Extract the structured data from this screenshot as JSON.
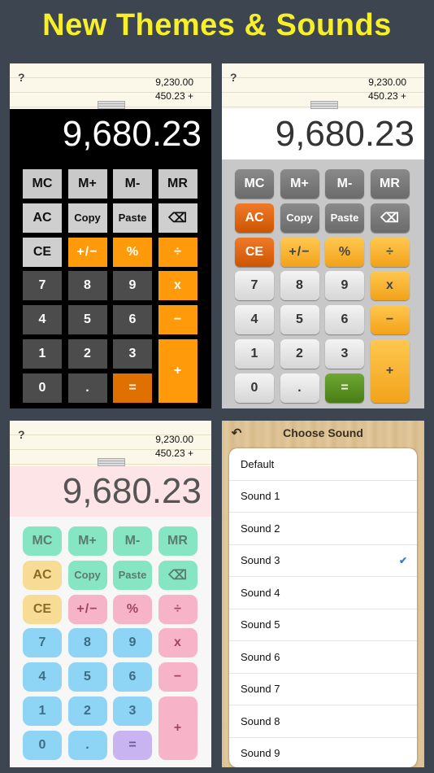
{
  "headline": "New Themes & Sounds",
  "tape": {
    "help": "?",
    "line1": "9,230.00",
    "line2": "450.23  +"
  },
  "display": "9,680.23",
  "keys": {
    "mc": "MC",
    "mplus": "M+",
    "mminus": "M-",
    "mr": "MR",
    "ac": "AC",
    "copy": "Copy",
    "paste": "Paste",
    "backspace": "⌫",
    "ce": "CE",
    "plusminus": "+/−",
    "percent": "%",
    "divide": "÷",
    "seven": "7",
    "eight": "8",
    "nine": "9",
    "multiply": "x",
    "four": "4",
    "five": "5",
    "six": "6",
    "minus": "−",
    "one": "1",
    "two": "2",
    "three": "3",
    "plus": "+",
    "zero": "0",
    "dot": ".",
    "equals": "="
  },
  "sound_panel": {
    "title": "Choose Sound",
    "back_icon": "undo-arrow-icon",
    "items": [
      "Default",
      "Sound 1",
      "Sound 2",
      "Sound 3",
      "Sound 4",
      "Sound 5",
      "Sound 6",
      "Sound 7",
      "Sound 8",
      "Sound 9"
    ],
    "selected": "Sound 3"
  },
  "colors": {
    "headline": "#f6ef2a",
    "background": "#3c4550",
    "theme1_operator": "#ff9a0a",
    "theme2_equals": "#4a7d15",
    "theme3_equals": "#c8b4f0",
    "check": "#2e7fd6"
  }
}
